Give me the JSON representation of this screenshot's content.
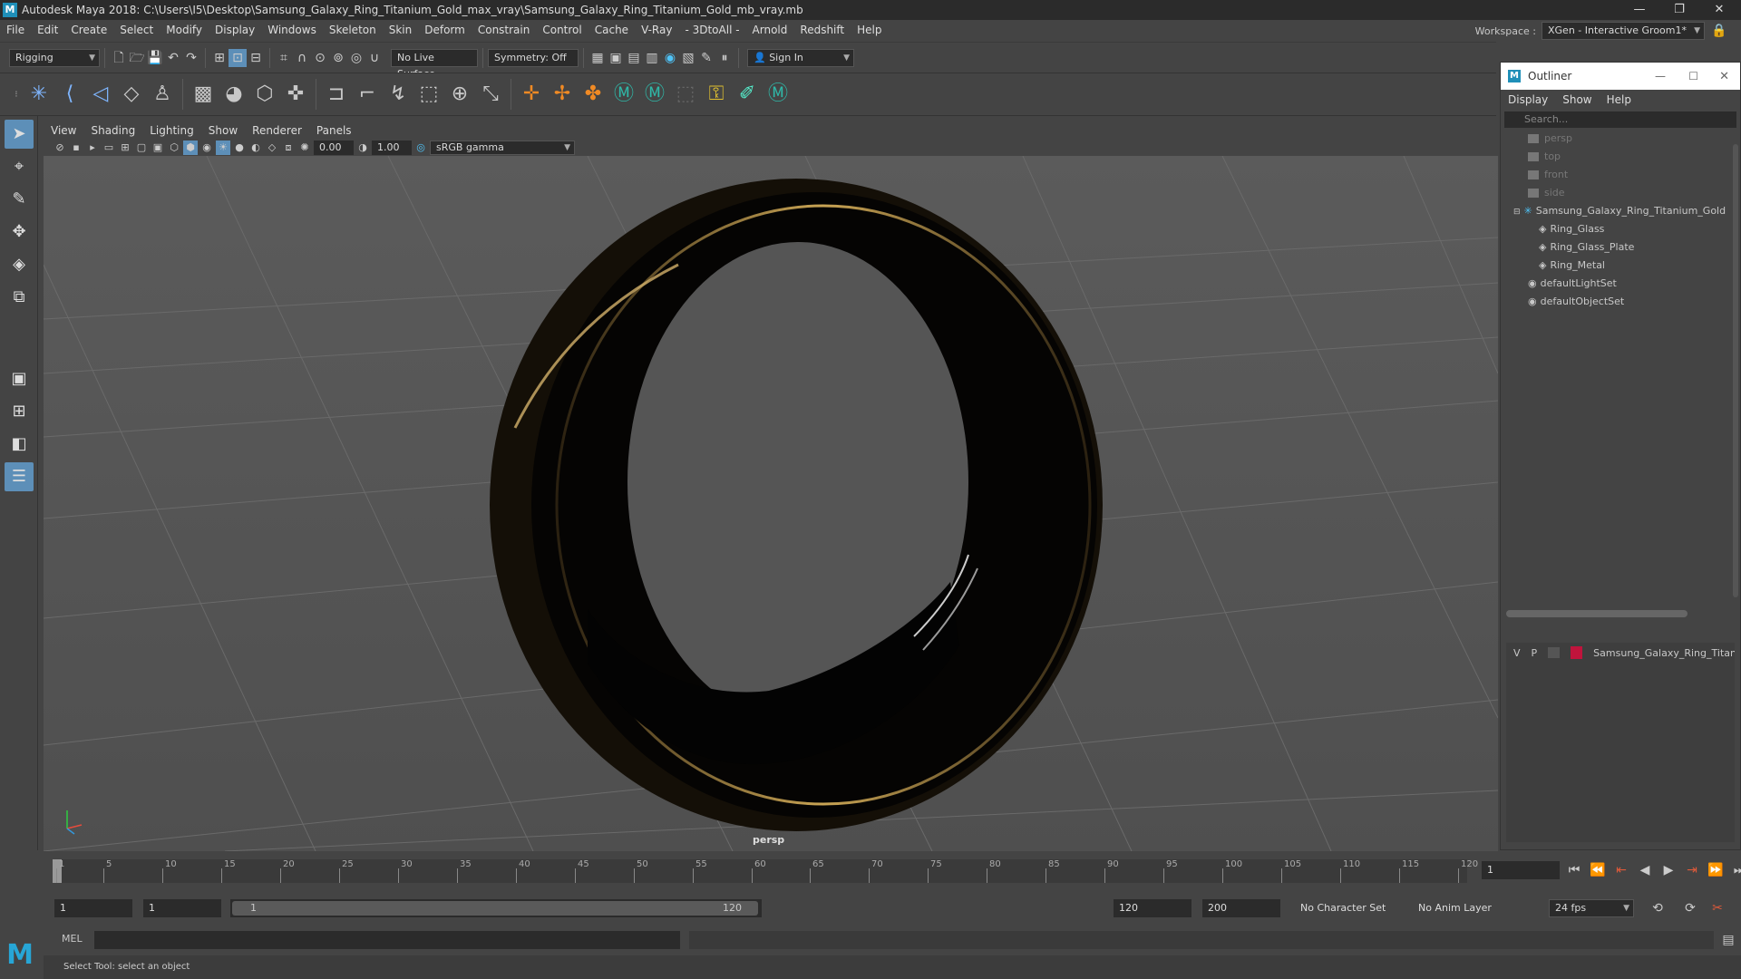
{
  "window": {
    "title": "Autodesk Maya 2018: C:\\Users\\I5\\Desktop\\Samsung_Galaxy_Ring_Titanium_Gold_max_vray\\Samsung_Galaxy_Ring_Titanium_Gold_mb_vray.mb",
    "minimize": "—",
    "restore": "❐",
    "close": "✕",
    "logo": "M"
  },
  "menubar": {
    "items": [
      "File",
      "Edit",
      "Create",
      "Select",
      "Modify",
      "Display",
      "Windows",
      "Skeleton",
      "Skin",
      "Deform",
      "Constrain",
      "Control",
      "Cache",
      "V-Ray",
      "- 3DtoAll -",
      "Arnold",
      "Redshift",
      "Help"
    ],
    "workspace_label": "Workspace :",
    "workspace_value": "XGen - Interactive Groom1*"
  },
  "statusline": {
    "mode": "Rigging",
    "live_surface": "No Live Surface",
    "symmetry": "Symmetry: Off",
    "sign_in": "Sign In"
  },
  "viewport": {
    "menu": [
      "View",
      "Shading",
      "Lighting",
      "Show",
      "Renderer",
      "Panels"
    ],
    "exposure": "0.00",
    "gamma": "1.00",
    "colorspace": "sRGB gamma",
    "camera": "persp"
  },
  "outliner": {
    "title": "Outliner",
    "menu": [
      "Display",
      "Show",
      "Help"
    ],
    "search_placeholder": "Search...",
    "cameras": [
      "persp",
      "top",
      "front",
      "side"
    ],
    "group": "Samsung_Galaxy_Ring_Titanium_Gold",
    "children": [
      "Ring_Glass",
      "Ring_Glass_Plate",
      "Ring_Metal"
    ],
    "sets": [
      "defaultLightSet",
      "defaultObjectSet"
    ],
    "layer_v": "V",
    "layer_p": "P",
    "layer_name": "Samsung_Galaxy_Ring_Titaniu",
    "layer_color": "#c0143c"
  },
  "timeline": {
    "ticks": [
      1,
      5,
      10,
      15,
      20,
      25,
      30,
      35,
      40,
      45,
      50,
      55,
      60,
      65,
      70,
      75,
      80,
      85,
      90,
      95,
      100,
      105,
      110,
      115,
      120
    ],
    "current_frame": "1"
  },
  "range": {
    "start": "1",
    "playback_start": "1",
    "slider_start": "1",
    "slider_end": "120",
    "playback_end": "120",
    "end": "200",
    "character_set": "No Character Set",
    "anim_layer": "No Anim Layer",
    "fps": "24 fps"
  },
  "cmdline": {
    "label": "MEL"
  },
  "helpline": {
    "text": "Select Tool: select an object"
  }
}
